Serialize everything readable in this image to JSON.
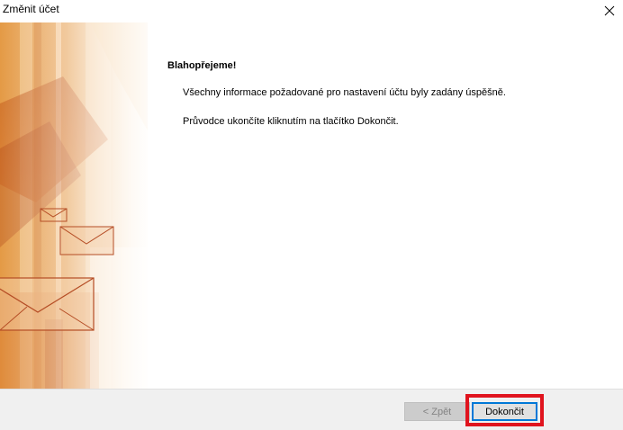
{
  "window": {
    "title": "Změnit účet",
    "close_icon": "close-icon"
  },
  "main": {
    "heading": "Blahopřejeme!",
    "message_1": "Všechny informace požadované pro nastavení účtu byly zadány úspěšně.",
    "message_2": "Průvodce ukončíte kliknutím na tlačítko Dokončit."
  },
  "footer": {
    "back_label": "< Zpět",
    "finish_label": "Dokončit"
  },
  "colors": {
    "highlight": "#e0141e",
    "focus_border": "#0078d7",
    "banner_orange": "#e08a2c"
  }
}
